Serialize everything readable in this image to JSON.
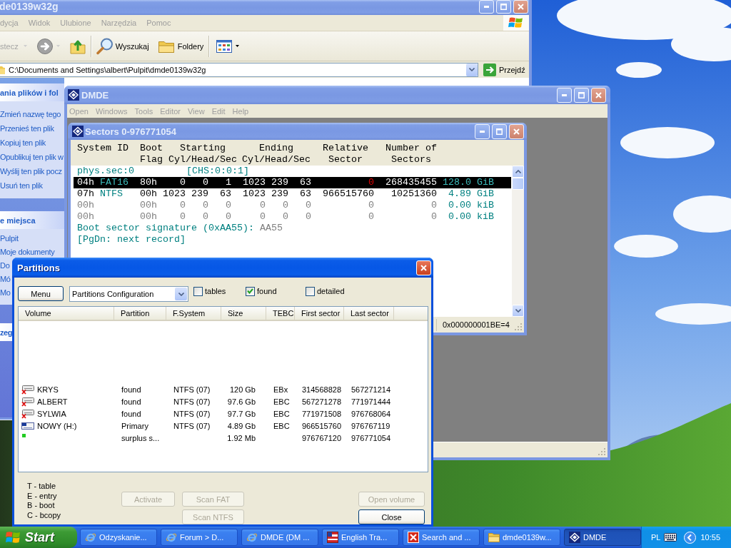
{
  "explorer": {
    "active": false,
    "title": "de0139w32g",
    "menu": [
      "dycja",
      "Widok",
      "Ulubione",
      "Narzędzia",
      "Pomoc"
    ],
    "toolbar": [
      {
        "kind": "back",
        "label": "stecz",
        "disabled": true
      },
      {
        "kind": "forward",
        "disabled": true
      },
      {
        "kind": "up",
        "disabled": false
      },
      {
        "kind": "search",
        "label": "Wyszukaj",
        "disabled": false
      },
      {
        "kind": "folders",
        "label": "Foldery",
        "disabled": false
      },
      {
        "kind": "views",
        "disabled": false
      }
    ],
    "address": {
      "value": "C:\\Documents and Settings\\albert\\Pulpit\\dmde0139w32g",
      "go": "Przejdź"
    },
    "task_panes": [
      {
        "title": "ania plików i fol",
        "items": [
          "Zmień nazwę tego",
          "Przenieś ten plik",
          "Kopiuj ten plik",
          "Opublikuj ten plik w",
          "Wyślij ten plik pocz",
          "Usuń ten plik"
        ]
      },
      {
        "title": "e miejsca",
        "items": [
          "Pulpit",
          "Moje dokumenty",
          "Do",
          "Mó",
          "Mo"
        ]
      },
      {
        "title": "zeg"
      }
    ]
  },
  "dmde": {
    "active": false,
    "title": "DMDE",
    "menu": [
      "Open",
      "Windows",
      "Tools",
      "Editor",
      "View",
      "Edit",
      "Help"
    ],
    "sectors_window": {
      "active": false,
      "title": "Sectors 0-976771054",
      "header": [
        {
          "lines": [
            "System ID"
          ]
        },
        {
          "lines": [
            "Boot",
            "Flag"
          ]
        },
        {
          "lines": [
            "Starting",
            "Cyl/Head/Sec"
          ]
        },
        {
          "lines": [
            "Ending",
            "Cyl/Head/Sec"
          ]
        },
        {
          "lines": [
            "Relative",
            "Sector"
          ]
        },
        {
          "lines": [
            "Number of",
            "Sectors"
          ]
        }
      ],
      "rows": [
        {
          "kind": "location",
          "segments": [
            "phys.sec:0",
            "[CHS:0:0:1]"
          ]
        },
        {
          "kind": "entry",
          "selected": true,
          "empty": false,
          "system_id": "04h",
          "fs": "FAT16",
          "boot_flag": "80h",
          "start": [
            "0",
            "0",
            "1"
          ],
          "end": [
            "1023",
            "239",
            "63"
          ],
          "relative_sector": "0",
          "relative_warning": true,
          "sectors": "268435455",
          "size": "128.0 GiB"
        },
        {
          "kind": "entry",
          "selected": false,
          "empty": false,
          "system_id": "07h",
          "fs": "NTFS",
          "boot_flag": "00h",
          "start": [
            "1023",
            "239",
            "63"
          ],
          "end": [
            "1023",
            "239",
            "63"
          ],
          "relative_sector": "966515760",
          "relative_warning": false,
          "sectors": "10251360",
          "size": "4.89 GiB"
        },
        {
          "kind": "entry",
          "selected": false,
          "empty": true,
          "system_id": "00h",
          "boot_flag": "00h",
          "start": [
            "0",
            "0",
            "0"
          ],
          "end": [
            "0",
            "0",
            "0"
          ],
          "relative_sector": "0",
          "relative_warning": false,
          "sectors": "0",
          "size": "0.00 kiB"
        },
        {
          "kind": "entry",
          "selected": false,
          "empty": true,
          "system_id": "00h",
          "boot_flag": "00h",
          "start": [
            "0",
            "0",
            "0"
          ],
          "end": [
            "0",
            "0",
            "0"
          ],
          "relative_sector": "0",
          "relative_warning": false,
          "sectors": "0",
          "size": "0.00 kiB"
        },
        {
          "kind": "signature",
          "label": "Boot sector signature (0xAA55):",
          "value": "AA55"
        },
        {
          "kind": "hint",
          "text": "[PgDn: next record]"
        }
      ],
      "status": "0x000000001BE=4"
    }
  },
  "partitions": {
    "active": true,
    "title": "Partitions",
    "menu_button": "Menu",
    "view_select": {
      "value": "Partitions Configuration"
    },
    "filters": [
      {
        "label": "tables",
        "checked": false
      },
      {
        "label": "found",
        "checked": true
      },
      {
        "label": "detailed",
        "checked": false
      }
    ],
    "columns": [
      "Volume",
      "Partition",
      "F.System",
      "Size",
      "TEBC",
      "First sector",
      "Last sector"
    ],
    "rows": [
      {
        "kind": "lost",
        "volume": "KRYS",
        "partition": "found",
        "fs": "NTFS (07)",
        "size": "120 Gb",
        "tebc": "EBx",
        "first_sector": "314568828",
        "last_sector": "567271214"
      },
      {
        "kind": "lost",
        "volume": "ALBERT",
        "partition": "found",
        "fs": "NTFS (07)",
        "size": "97.6 Gb",
        "tebc": "EBC",
        "first_sector": "567271278",
        "last_sector": "771971444"
      },
      {
        "kind": "lost",
        "volume": "SYLWIA",
        "partition": "found",
        "fs": "NTFS (07)",
        "size": "97.7 Gb",
        "tebc": "EBC",
        "first_sector": "771971508",
        "last_sector": "976768064"
      },
      {
        "kind": "primary",
        "volume": "NOWY (H:)",
        "partition": "Primary",
        "fs": "NTFS (07)",
        "size": "4.89 Gb",
        "tebc": "EBC",
        "first_sector": "966515760",
        "last_sector": "976767119"
      },
      {
        "kind": "free",
        "partition": "surplus s...",
        "size": "1.92 Mb",
        "first_sector": "976767120",
        "last_sector": "976771054"
      }
    ],
    "legend": [
      "T - table",
      "E - entry",
      "B - boot",
      "C - bcopy"
    ],
    "buttons": [
      {
        "label": "Activate",
        "disabled": true
      },
      {
        "label": "Scan FAT",
        "disabled": true
      },
      {
        "label": "Scan NTFS",
        "disabled": true
      },
      {
        "label": "Open volume",
        "disabled": true
      },
      {
        "label": "Close",
        "disabled": false
      }
    ]
  },
  "taskbar": {
    "start": "Start",
    "tasks": [
      {
        "kind": "browser",
        "label": "Odzyskanie...",
        "selected": false
      },
      {
        "kind": "browser",
        "label": "Forum > D...",
        "selected": false
      },
      {
        "kind": "browser",
        "label": "DMDE (DM ...",
        "selected": false
      },
      {
        "kind": "translator",
        "label": "English Tra...",
        "selected": false
      },
      {
        "kind": "checker",
        "label": "Search and ...",
        "selected": false
      },
      {
        "kind": "folder",
        "label": "dmde0139w...",
        "selected": false
      },
      {
        "kind": "disk_editor",
        "label": "DMDE",
        "selected": true
      }
    ],
    "language": "PL",
    "clock": "10:55"
  }
}
